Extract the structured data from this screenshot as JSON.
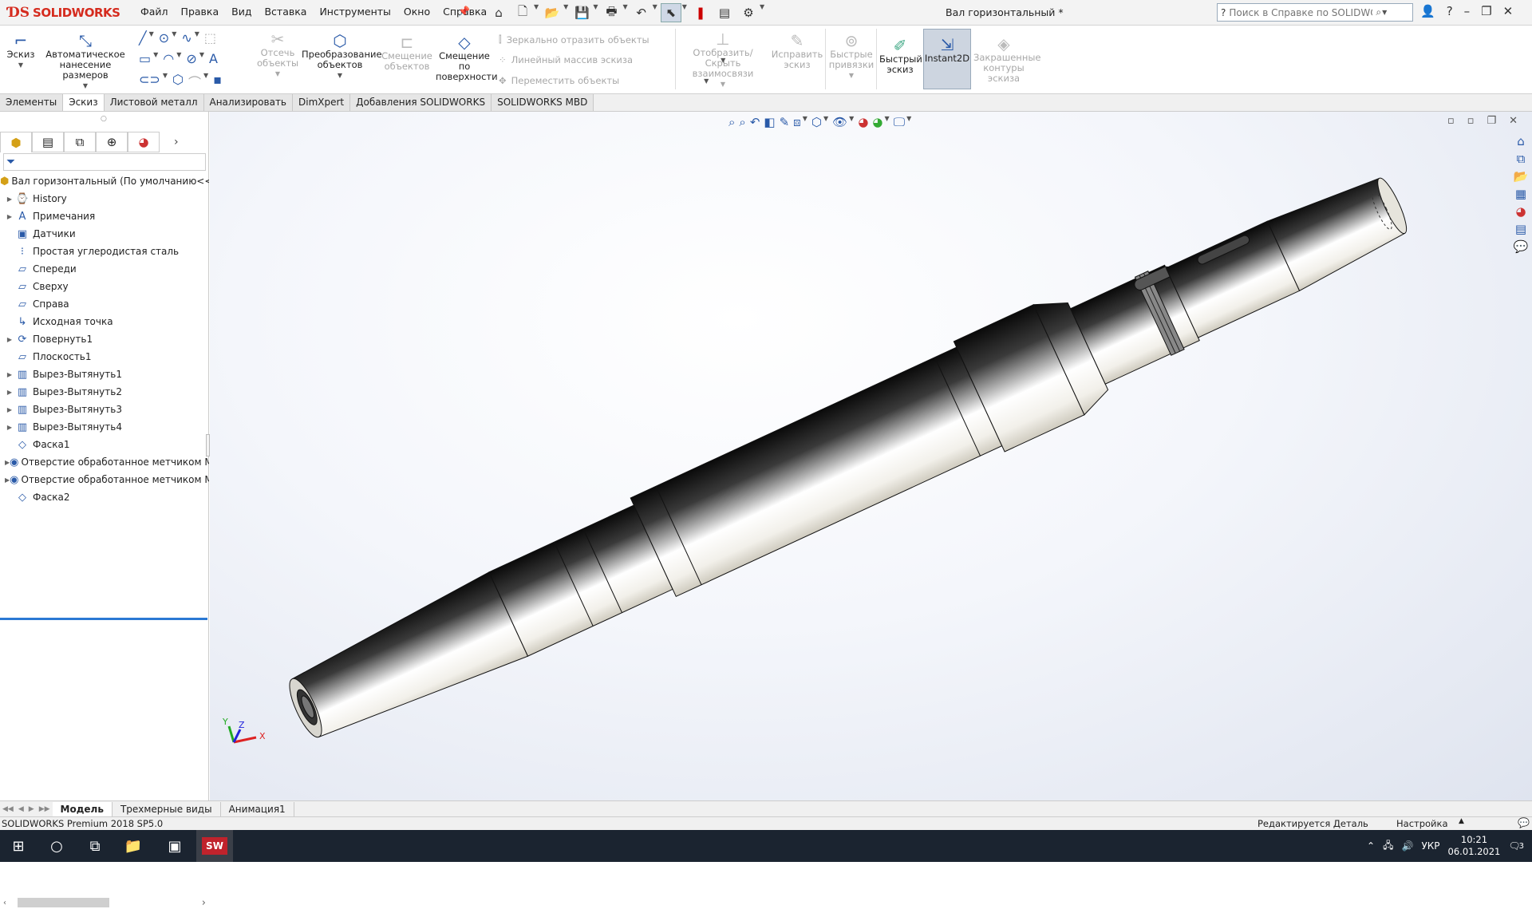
{
  "app": {
    "logo_text": "SOLIDWORKS",
    "document_title": "Вал горизонтальный *"
  },
  "menu": [
    "Файл",
    "Правка",
    "Вид",
    "Вставка",
    "Инструменты",
    "Окно",
    "Справка"
  ],
  "search": {
    "placeholder": "Поиск в Справке по SOLIDWORKS"
  },
  "ribbon": {
    "sketch": "Эскиз",
    "smart_dim": "Автоматическое нанесение размеров",
    "trim": "Отсечь объекты",
    "convert": "Преобразование объектов",
    "offset": "Смещение объектов",
    "offset_surface": "Смещение по поверхности",
    "mirror": "Зеркально отразить объекты",
    "linear_pattern": "Линейный массив эскиза",
    "move": "Переместить объекты",
    "display_relations": "Отобразить/Скрыть взаимосвязи",
    "repair": "Исправить эскиз",
    "quick_snaps": "Быстрые привязки",
    "rapid_sketch": "Быстрый эскиз",
    "instant2d": "Instant2D",
    "shaded_contours": "Закрашенные контуры эскиза"
  },
  "command_tabs": [
    "Элементы",
    "Эскиз",
    "Листовой металл",
    "Анализировать",
    "DimXpert",
    "Добавления SOLIDWORKS",
    "SOLIDWORKS MBD"
  ],
  "active_command_tab": 1,
  "tree": {
    "root": "Вал горизонтальный  (По умолчанию<<По умолчанию>_Сост",
    "items": [
      {
        "label": "History",
        "icon": "history-icon",
        "expand": true
      },
      {
        "label": "Примечания",
        "icon": "annotations-icon",
        "expand": true
      },
      {
        "label": "Датчики",
        "icon": "sensors-icon",
        "expand": false
      },
      {
        "label": "Простая углеродистая сталь",
        "icon": "material-icon",
        "expand": false
      },
      {
        "label": "Спереди",
        "icon": "plane-icon",
        "expand": false
      },
      {
        "label": "Сверху",
        "icon": "plane-icon",
        "expand": false
      },
      {
        "label": "Справа",
        "icon": "plane-icon",
        "expand": false
      },
      {
        "label": "Исходная точка",
        "icon": "origin-icon",
        "expand": false
      },
      {
        "label": "Повернуть1",
        "icon": "revolve-icon",
        "expand": true
      },
      {
        "label": "Плоскость1",
        "icon": "plane-icon",
        "expand": false
      },
      {
        "label": "Вырез-Вытянуть1",
        "icon": "cut-extrude-icon",
        "expand": true
      },
      {
        "label": "Вырез-Вытянуть2",
        "icon": "cut-extrude-icon",
        "expand": true
      },
      {
        "label": "Вырез-Вытянуть3",
        "icon": "cut-extrude-icon",
        "expand": true
      },
      {
        "label": "Вырез-Вытянуть4",
        "icon": "cut-extrude-icon",
        "expand": true
      },
      {
        "label": "Фаска1",
        "icon": "chamfer-icon",
        "expand": false
      },
      {
        "label": "Отверстие обработанное метчиком М",
        "icon": "hole-wizard-icon",
        "expand": true
      },
      {
        "label": "Отверстие обработанное метчиком М",
        "icon": "hole-wizard-icon",
        "expand": true
      },
      {
        "label": "Фаска2",
        "icon": "chamfer-icon",
        "expand": false
      }
    ]
  },
  "model_tabs": [
    "Модель",
    "Трехмерные виды",
    "Анимация1"
  ],
  "status": {
    "product": "SOLIDWORKS Premium 2018 SP5.0",
    "mode": "Редактируется Деталь",
    "custom": "Настройка"
  },
  "taskbar": {
    "lang": "УКР",
    "time": "10:21",
    "date": "06.01.2021",
    "notifications": "3"
  },
  "triad": {
    "x": "X",
    "y": "Y",
    "z": "Z"
  },
  "colors": {
    "accent": "#2a5aa8",
    "brand": "#d52b1e",
    "taskbar": "#1b2430"
  }
}
